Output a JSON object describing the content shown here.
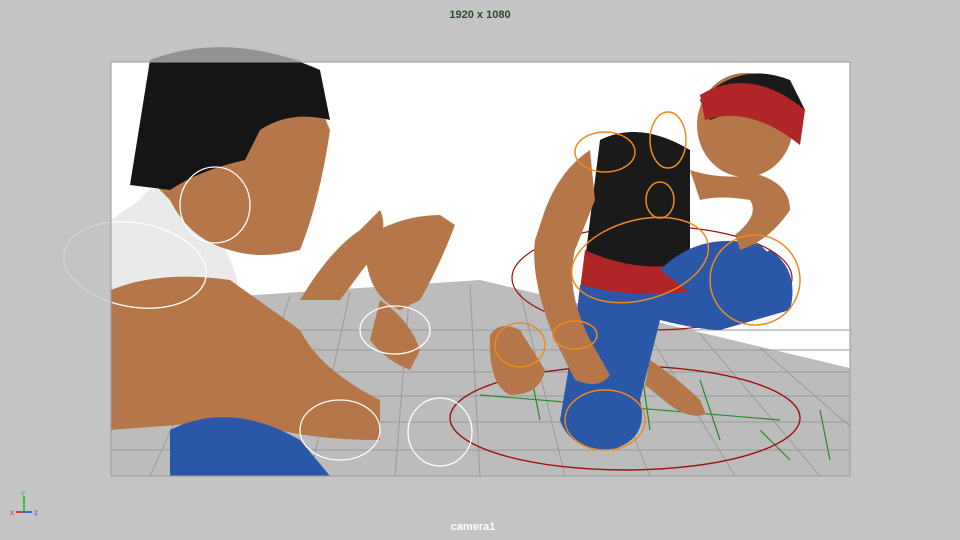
{
  "viewport": {
    "resolution_label": "1920 x 1080",
    "camera_label": "camera1"
  },
  "axis_gizmo": {
    "x_label": "x",
    "y_label": "y",
    "z_label": "z",
    "x_color": "#d43a3a",
    "y_color": "#3ac43a",
    "z_color": "#3a6ad4"
  },
  "colors": {
    "gate_mask": "#c4c4c4",
    "background_white": "#ffffff",
    "grid_floor": "#bcbcbc",
    "skin": "#b5774a",
    "hair": "#151515",
    "shirt_black": "#1a1a1a",
    "shirt_white": "#eaeaea",
    "pants_blue": "#2a57a8",
    "headband_red": "#b02626",
    "control_orange": "#ee8a1e",
    "control_red": "#9e1010",
    "control_white": "#ffffff"
  }
}
